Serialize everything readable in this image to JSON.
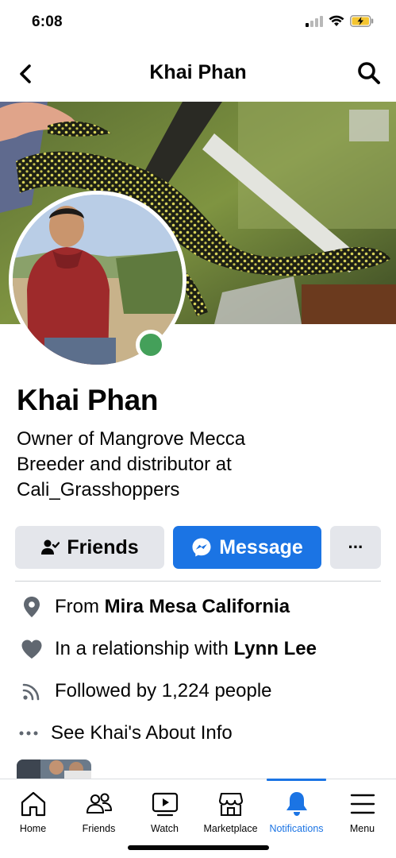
{
  "status_bar": {
    "time": "6:08",
    "icons": [
      "signal-icon",
      "wifi-icon",
      "battery-charging-icon"
    ]
  },
  "header": {
    "title": "Khai Phan",
    "back_icon": "chevron-left-icon",
    "search_icon": "search-icon"
  },
  "profile": {
    "name": "Khai Phan",
    "online": true,
    "bio_lines": [
      "Owner of Mangrove Mecca",
      "Breeder and distributor at",
      "Cali_Grasshoppers"
    ]
  },
  "actions": {
    "friends_label": "Friends",
    "message_label": "Message",
    "more_label": "···"
  },
  "details": {
    "from": {
      "prefix": "From ",
      "place": "Mira Mesa California",
      "icon": "location-pin-icon"
    },
    "relationship": {
      "prefix": "In a relationship with ",
      "partner": "Lynn Lee",
      "icon": "heart-icon"
    },
    "followers": {
      "text": "Followed by 1,224 people",
      "icon": "rss-icon"
    },
    "about": {
      "text": "See Khai's About Info",
      "icon": "more-dots-icon"
    }
  },
  "bottom_nav": {
    "items": [
      {
        "label": "Home",
        "icon": "home-icon"
      },
      {
        "label": "Friends",
        "icon": "friends-icon"
      },
      {
        "label": "Watch",
        "icon": "watch-icon"
      },
      {
        "label": "Marketplace",
        "icon": "marketplace-icon"
      },
      {
        "label": "Notifications",
        "icon": "bell-icon",
        "active": true
      },
      {
        "label": "Menu",
        "icon": "menu-icon"
      }
    ]
  },
  "colors": {
    "accent": "#1b74e4",
    "online": "#44a05a",
    "button_gray": "#e4e6eb",
    "text": "#050505"
  }
}
